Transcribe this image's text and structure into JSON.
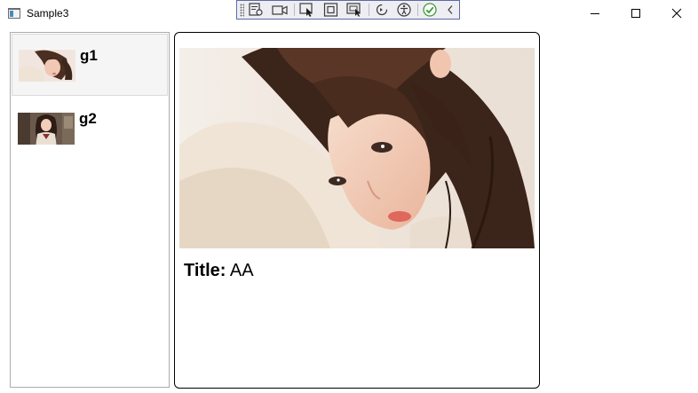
{
  "window": {
    "title": "Sample3"
  },
  "debug_toolbar": {
    "icons": [
      "live-visual-tree-icon",
      "video-camera-icon",
      "select-element-icon",
      "display-layout-adorners-icon",
      "track-focus-icon",
      "hot-reload-icon",
      "accessibility-icon",
      "check-icon",
      "collapse-chevron-icon"
    ]
  },
  "list": {
    "items": [
      {
        "label": "g1",
        "selected": true
      },
      {
        "label": "g2",
        "selected": false
      }
    ]
  },
  "detail": {
    "title_label": "Title:",
    "title_value": "AA"
  },
  "colors": {
    "selection_background": "#f5f5f5",
    "toolbar_background": "#eeeef2",
    "toolbar_border": "#5b6aa8"
  }
}
